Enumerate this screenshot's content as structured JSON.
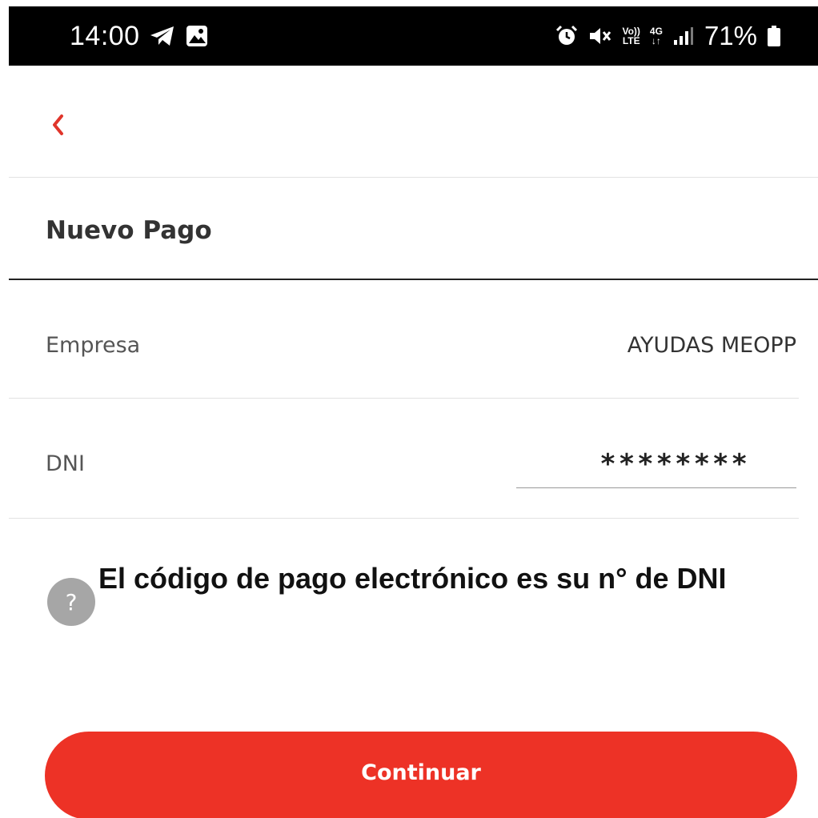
{
  "status_bar": {
    "time": "14:00",
    "left_icons": [
      "telegram-icon",
      "gallery-icon"
    ],
    "right_icons": [
      "alarm-icon",
      "mute-icon",
      "volte-icon",
      "4g-icon",
      "signal-icon",
      "battery-icon"
    ],
    "volte_top": "Vo))",
    "volte_bottom": "LTE",
    "network_top": "4G",
    "network_bottom": "↓↑",
    "battery": "71%"
  },
  "header": {
    "back_icon": "chevron-left-icon",
    "accent_color": "#e0352b"
  },
  "page": {
    "title": "Nuevo Pago"
  },
  "form": {
    "company_label": "Empresa",
    "company_value": "AYUDAS MEOPP",
    "dni_label": "DNI",
    "dni_value": "********"
  },
  "help": {
    "icon_glyph": "?",
    "text": "El código de pago electrónico es su n° de DNI"
  },
  "actions": {
    "continue_label": "Continuar",
    "button_color": "#ed3226"
  }
}
